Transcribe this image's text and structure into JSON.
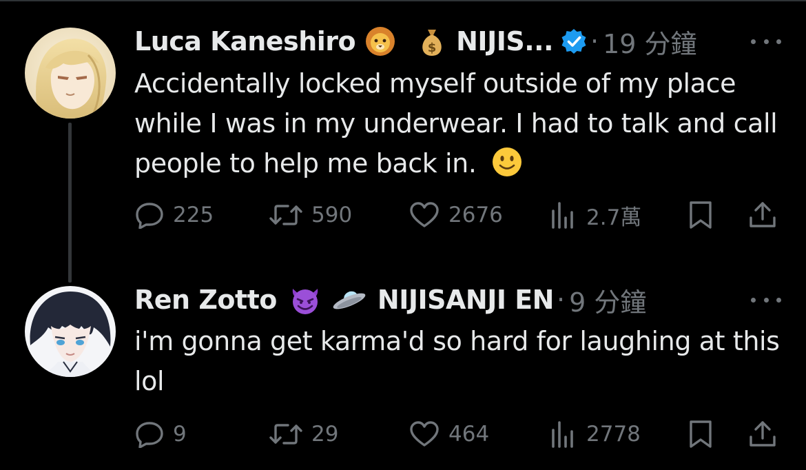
{
  "tweets": [
    {
      "author": "Luca Kaneshiro",
      "name_emoji": "lion-face",
      "affiliation_emoji": "money-bag",
      "affiliation": "NIJIS...",
      "verified": true,
      "separator": "·",
      "time": "19 分鐘",
      "text": "Accidentally locked myself outside of my place while I was in my underwear. I had to talk and call people to help me back in.",
      "text_emoji": "slightly-smiling-face",
      "replies": "225",
      "reposts": "590",
      "likes": "2676",
      "views": "2.7萬"
    },
    {
      "author": "Ren Zotto",
      "name_emoji": "smiling-face-with-horns",
      "affiliation_emoji": "flying-saucer",
      "affiliation": "NIJISANJI EN",
      "verified": false,
      "separator": "·",
      "time": "9 分鐘",
      "text": "i'm gonna get karma'd so hard for laughing at this lol",
      "replies": "9",
      "reposts": "29",
      "likes": "464",
      "views": "2778"
    }
  ],
  "colors": {
    "background": "#000000",
    "primary_text": "#e7e9ea",
    "secondary_text": "#71767b",
    "verified_blue": "#1d9bf0",
    "thread_line": "#333639"
  }
}
